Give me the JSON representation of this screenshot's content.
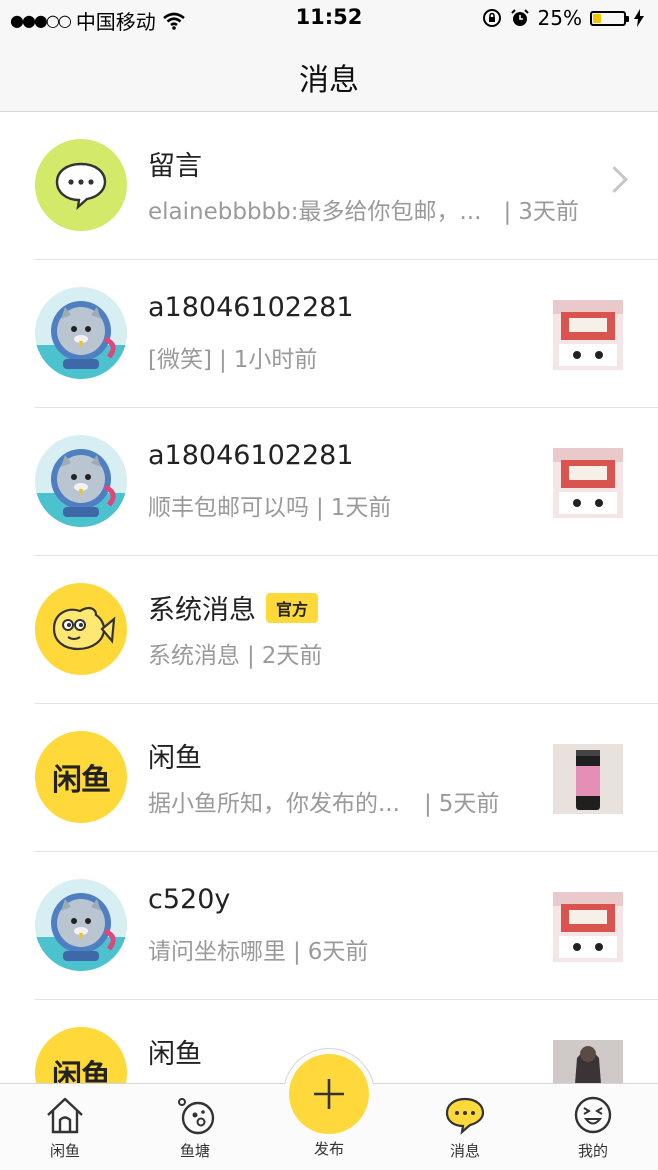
{
  "status": {
    "carrier": "中国移动",
    "time": "11:52",
    "battery": "25%",
    "battery_level": 0.25
  },
  "nav": {
    "title": "消息"
  },
  "messages": [
    {
      "name": "留言",
      "preview": "elainebbbbb:最多给你包邮，...",
      "time": "3天前",
      "avatar": "comment-bubble-icon"
    },
    {
      "name": "a18046102281",
      "preview": "[微笑]",
      "time": "1小时前",
      "avatar": "seal-astronaut-avatar"
    },
    {
      "name": "a18046102281",
      "preview": "顺丰包邮可以吗",
      "time": "1天前",
      "avatar": "seal-astronaut-avatar"
    },
    {
      "name": "系统消息",
      "badge": "官方",
      "preview": "系统消息",
      "time": "2天前",
      "avatar": "fish-mascot-avatar"
    },
    {
      "name": "闲鱼",
      "preview": "据小鱼所知，你发布的...",
      "time": "5天前",
      "avatar": "xianyu-logo",
      "logo_text": "闲鱼"
    },
    {
      "name": "c520y",
      "preview": "请问坐标哪里",
      "time": "6天前",
      "avatar": "seal-astronaut-avatar"
    },
    {
      "name": "闲鱼",
      "preview": "",
      "time": "",
      "avatar": "xianyu-logo",
      "logo_text": "闲鱼"
    }
  ],
  "tabbar": {
    "home": "闲鱼",
    "pond": "鱼塘",
    "publish": "发布",
    "messages": "消息",
    "mine": "我的"
  },
  "colors": {
    "accent": "#ffd93b",
    "comment_green": "#d3e96a",
    "text_gray": "#9a9a9a"
  }
}
